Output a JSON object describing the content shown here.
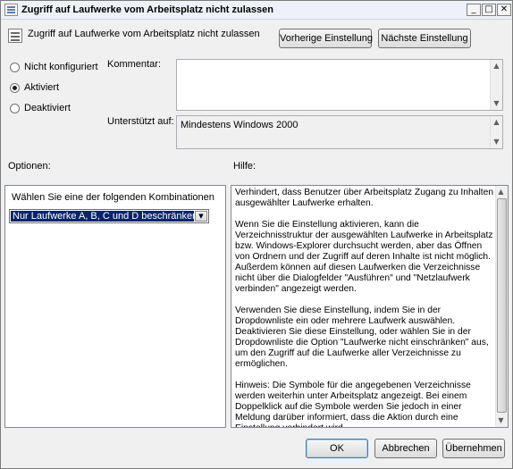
{
  "window": {
    "title": "Zugriff auf Laufwerke vom Arbeitsplatz nicht zulassen",
    "caption_buttons": {
      "minimize": "_",
      "maximize": "□",
      "close": "✕"
    }
  },
  "header": {
    "policy_name": "Zugriff auf Laufwerke vom Arbeitsplatz nicht zulassen",
    "prev_button": "Vorherige Einstellung",
    "next_button": "Nächste Einstellung"
  },
  "state": {
    "options": [
      {
        "label": "Nicht konfiguriert",
        "selected": false
      },
      {
        "label": "Aktiviert",
        "selected": true
      },
      {
        "label": "Deaktiviert",
        "selected": false
      }
    ]
  },
  "comment": {
    "label": "Kommentar:",
    "value": ""
  },
  "supported": {
    "label": "Unterstützt auf:",
    "value": "Mindestens Windows 2000"
  },
  "options_section": {
    "label": "Optionen:",
    "combo_label": "Wählen Sie eine der folgenden Kombinationen",
    "selected_value": "Nur Laufwerke A, B, C und D beschränken"
  },
  "help_section": {
    "label": "Hilfe:",
    "paragraphs": [
      "Verhindert, dass Benutzer über Arbeitsplatz Zugang zu Inhalten ausgewählter Laufwerke erhalten.",
      "Wenn Sie die Einstellung aktivieren, kann die Verzeichnisstruktur der ausgewählten Laufwerke in Arbeitsplatz bzw. Windows-Explorer durchsucht werden, aber das Öffnen von Ordnern und der Zugriff auf deren Inhalte ist nicht möglich. Außerdem können auf diesen Laufwerken die Verzeichnisse nicht über die Dialogfelder \"Ausführen\" und \"Netzlaufwerk verbinden\" angezeigt werden.",
      "Verwenden Sie diese Einstellung, indem Sie in der Dropdownliste ein oder mehrere Laufwerk auswählen. Deaktivieren Sie diese Einstellung, oder wählen Sie in der Dropdownliste die Option \"Laufwerke nicht einschränken\" aus, um den Zugriff auf die Laufwerke aller Verzeichnisse zu ermöglichen.",
      "Hinweis: Die Symbole für die angegebenen Verzeichnisse werden weiterhin unter Arbeitsplatz angezeigt. Bei einem Doppelklick auf die Symbole werden Sie jedoch in einer Meldung darüber informiert, dass die Aktion durch eine Einstellung verhindert wird."
    ]
  },
  "footer": {
    "ok": "OK",
    "cancel": "Abbrechen",
    "apply": "Übernehmen"
  },
  "icons": {
    "scroll_up": "▲",
    "scroll_down": "▼",
    "dropdown_arrow": "▼"
  }
}
